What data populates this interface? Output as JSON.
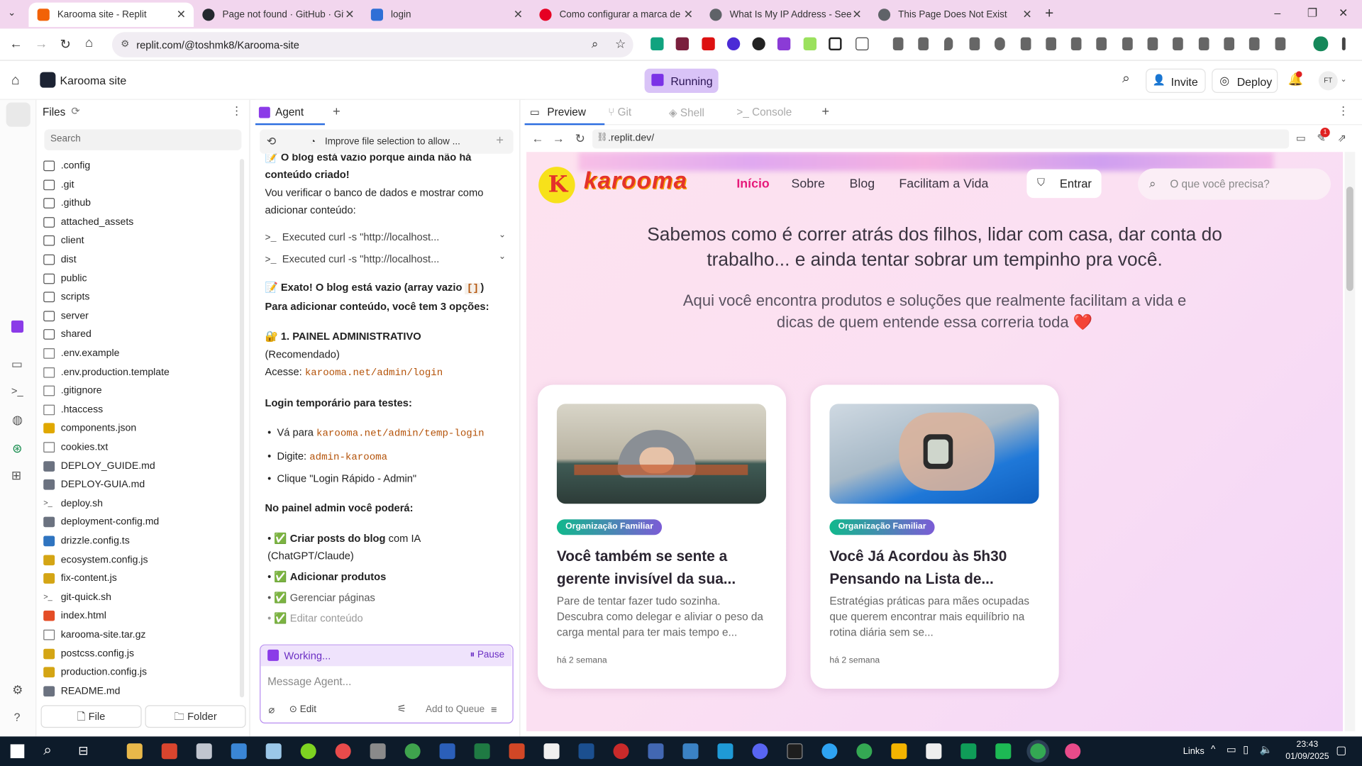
{
  "browser": {
    "tabs": [
      {
        "title": "Karooma site - Replit",
        "color": "#f26207"
      },
      {
        "title": "Page not found · GitHub · GitHub",
        "color": "#24292f"
      },
      {
        "title": "login",
        "color": "#2f6fd6"
      },
      {
        "title": "Como configurar a marca de lin",
        "color": "#e60023"
      },
      {
        "title": "What Is My IP Address - See Yo",
        "color": "#5f6368"
      },
      {
        "title": "This Page Does Not Exist",
        "color": "#5f6368"
      }
    ],
    "url": "replit.com/@toshmk8/Karooma-site",
    "new_tab": "+",
    "win_min": "–",
    "win_max": "❐",
    "win_close": "✕"
  },
  "replit": {
    "project": "Karooma site",
    "run_label": "Running",
    "invite": "Invite",
    "deploy": "Deploy",
    "avatar": "FT",
    "files_title": "Files",
    "search_placeholder": "Search",
    "file_btn": "File",
    "folder_btn": "Folder",
    "files": [
      {
        "name": ".config",
        "type": "folder"
      },
      {
        "name": ".git",
        "type": "folder"
      },
      {
        "name": ".github",
        "type": "folder"
      },
      {
        "name": "attached_assets",
        "type": "folder"
      },
      {
        "name": "client",
        "type": "folder"
      },
      {
        "name": "dist",
        "type": "folder"
      },
      {
        "name": "public",
        "type": "folder"
      },
      {
        "name": "scripts",
        "type": "folder"
      },
      {
        "name": "server",
        "type": "folder"
      },
      {
        "name": "shared",
        "type": "folder"
      },
      {
        "name": ".env.example",
        "type": "file"
      },
      {
        "name": ".env.production.template",
        "type": "file"
      },
      {
        "name": ".gitignore",
        "type": "file"
      },
      {
        "name": ".htaccess",
        "type": "file"
      },
      {
        "name": "components.json",
        "type": "json"
      },
      {
        "name": "cookies.txt",
        "type": "file"
      },
      {
        "name": "DEPLOY_GUIDE.md",
        "type": "md"
      },
      {
        "name": "DEPLOY-GUIA.md",
        "type": "md"
      },
      {
        "name": "deploy.sh",
        "type": "sh"
      },
      {
        "name": "deployment-config.md",
        "type": "md"
      },
      {
        "name": "drizzle.config.ts",
        "type": "ts"
      },
      {
        "name": "ecosystem.config.js",
        "type": "js"
      },
      {
        "name": "fix-content.js",
        "type": "js"
      },
      {
        "name": "git-quick.sh",
        "type": "sh"
      },
      {
        "name": "index.html",
        "type": "html"
      },
      {
        "name": "karooma-site.tar.gz",
        "type": "file"
      },
      {
        "name": "postcss.config.js",
        "type": "js"
      },
      {
        "name": "production.config.js",
        "type": "js"
      },
      {
        "name": "README.md",
        "type": "md"
      }
    ]
  },
  "agent": {
    "tab": "Agent",
    "add_tab": "+",
    "improve_text": "Improve file selection to allow ...",
    "msg1a": "📝 O blog está vazio porque ainda não há",
    "msg1b": "conteúdo criado!",
    "msg2a": "Vou verificar o banco de dados e mostrar como",
    "msg2b": "adicionar conteúdo:",
    "exec1": "Executed curl -s \"http://localhost...",
    "exec2": "Executed curl -s \"http://localhost...",
    "exato": "📝 Exato! O blog está vazio (array vazio",
    "exato_code": "[]",
    "exato_end": ")",
    "para": "Para adicionar conteúdo, você tem 3 opções:",
    "painel_a": "🔐 1. PAINEL ADMINISTRATIVO",
    "painel_b": "(Recomendado)",
    "acesse": "Acesse:",
    "acesse_url": "karooma.net/admin/login",
    "login_temp": "Login temporário para testes:",
    "b1_pre": "Vá para",
    "b1_url": "karooma.net/admin/temp-login",
    "b2_pre": "Digite:",
    "b2_code": "admin-karooma",
    "b3": "Clique \"Login Rápido - Admin\"",
    "no_painel": "No painel admin você poderá:",
    "c1_bold": "Criar posts do blog",
    "c1_rest": "com IA",
    "c1_b": "(ChatGPT/Claude)",
    "c2": "Adicionar produtos",
    "c3": "Gerenciar páginas",
    "c4": "Editar conteúdo",
    "working": "Working...",
    "pause": "Pause",
    "msg_placeholder": "Message Agent...",
    "edit": "Edit",
    "add_queue": "Add to Queue"
  },
  "preview": {
    "tabs": [
      "Preview",
      "Git",
      "Shell",
      "Console"
    ],
    "add": "+",
    "url": ".replit.dev/",
    "notif_count": "1"
  },
  "site": {
    "logo": "karooma",
    "nav": [
      "Início",
      "Sobre",
      "Blog",
      "Facilitam a Vida"
    ],
    "login": "Entrar",
    "search_placeholder": "O que você precisa?",
    "hero_a": "Sabemos como é correr atrás dos filhos, lidar com casa, dar conta do",
    "hero_b": "trabalho... e ainda tentar sobrar um tempinho pra você.",
    "sub_a": "Aqui você encontra produtos e soluções que realmente facilitam a vida e",
    "sub_b": "dicas de quem entende essa correria toda ❤️",
    "cards": [
      {
        "tag": "Organização Familiar",
        "title": "Você também se sente a gerente invisível da sua...",
        "desc": "Pare de tentar fazer tudo sozinha. Descubra como delegar e aliviar o peso da carga mental para ter mais tempo e...",
        "date": "há 2 semana"
      },
      {
        "tag": "Organização Familiar",
        "title": "Você Já Acordou às 5h30 Pensando na Lista de...",
        "desc": "Estratégias práticas para mães ocupadas que querem encontrar mais equilíbrio na rotina diária sem se...",
        "date": "há 2 semana"
      }
    ]
  },
  "taskbar": {
    "links": "Links",
    "time": "23:43",
    "date": "01/09/2025"
  }
}
